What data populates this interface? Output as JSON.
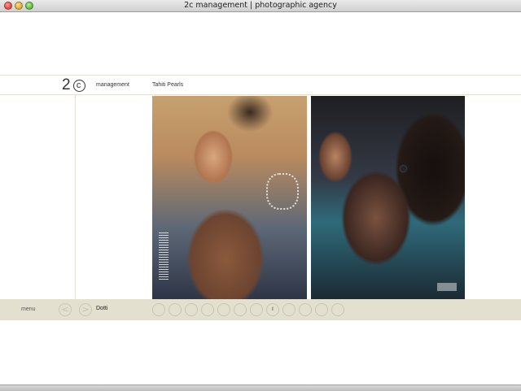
{
  "window": {
    "title": "2c management | photographic agency"
  },
  "header": {
    "logo_text": "2",
    "logo_symbol": "c",
    "nav_label": "management",
    "gallery_title": "Tahiti Pearls"
  },
  "gallery": {
    "left_photo": "Model with pearl bracelets",
    "right_photo": "Model profile with pearl earring"
  },
  "footer": {
    "menu_label": "menu",
    "prev_symbol": "<",
    "next_symbol": ">",
    "client_name": "Dotti",
    "pages": [
      "",
      "",
      "",
      "",
      "",
      "",
      "",
      "I",
      "",
      "",
      "",
      ""
    ],
    "current_page_index": 7
  },
  "colors": {
    "accent_band": "#e4e0cf",
    "text": "#222222"
  }
}
